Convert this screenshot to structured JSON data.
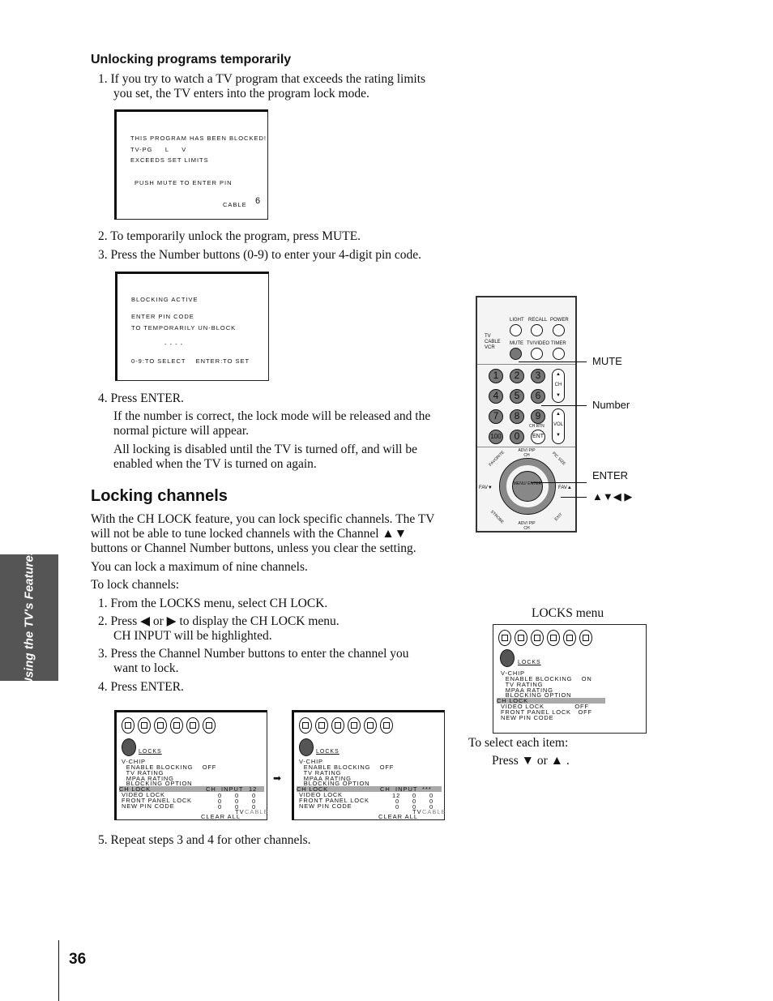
{
  "sidebar_tab": "Using the TV's Features",
  "page_number": "36",
  "unlock": {
    "heading": "Unlocking programs temporarily",
    "step1": "1.  If you try to watch a TV program that exceeds the rating limits",
    "step1b": "you set, the TV enters into the program lock mode.",
    "step2": "2.  To temporarily unlock the program, press MUTE.",
    "step3": "3.  Press the Number buttons (0-9) to enter your 4-digit pin code.",
    "step4": "4.  Press ENTER.",
    "step4a": "If the number is correct, the lock mode will be released and the",
    "step4b": "normal picture will appear.",
    "step4c": "All locking is disabled until the TV is turned off, and will be",
    "step4d": "enabled when the TV is turned on again."
  },
  "screen_blocked": {
    "l1": "THIS PROGRAM HAS BEEN BLOCKED!",
    "l2": "TV-PG     L     V",
    "l3": "EXCEEDS SET LIMITS",
    "l4": "PUSH MUTE TO ENTER PIN",
    "source": "CABLE",
    "channel": "6"
  },
  "screen_pin": {
    "l1": "BLOCKING ACTIVE",
    "l2": "ENTER PIN CODE",
    "l3": "TO TEMPORARILY UN-BLOCK",
    "l4": "- - - -",
    "l5": "0-9:TO SELECT    ENTER:TO SET"
  },
  "locking": {
    "heading": "Locking channels",
    "p1a": "With the CH LOCK feature, you can lock specific channels. The TV",
    "p1b": "will not be able to tune locked channels with the Channel ▲▼",
    "p1c": "buttons or Channel Number buttons, unless you clear the setting.",
    "p2": "You can lock a maximum of nine channels.",
    "p3": "To lock channels:",
    "s1": "1.  From the LOCKS menu, select CH LOCK.",
    "s2": "2.  Press ◀ or ▶ to display the CH LOCK menu.",
    "s2b": "CH INPUT will be highlighted.",
    "s3": "3.  Press the Channel Number buttons to enter the channel you",
    "s3b": "want to lock.",
    "s4": "4.  Press ENTER.",
    "s5": "5.  Repeat steps 3 and 4 for other channels."
  },
  "remote": {
    "top_buttons": [
      "LIGHT",
      "RECALL",
      "POWER",
      "MUTE",
      "TV/VIDEO",
      "TIMER"
    ],
    "switch": [
      "TV",
      "CABLE",
      "VCR"
    ],
    "numbers": [
      "1",
      "2",
      "3",
      "4",
      "5",
      "6",
      "7",
      "8",
      "9",
      "100",
      "0",
      "ENT"
    ],
    "ch": "CH",
    "vol": "VOL",
    "chrtn": "CH RTN",
    "nav_up": "ADV/ PIP CH",
    "nav_down": "ADV/ PIP CH",
    "fav_left": "FAV▼",
    "fav_right": "FAV▲",
    "center": "MENU/ ENTER",
    "corners": [
      "FAVORITE",
      "PIC SIZE",
      "STROBE",
      "EXIT"
    ],
    "callouts": {
      "mute": "MUTE",
      "number": "Number",
      "enter": "ENTER",
      "arrows": "▲▼◀ ▶"
    }
  },
  "locks_menu": {
    "caption": "LOCKS menu",
    "title": "LOCKS",
    "rows": [
      "V-CHIP",
      "  ENABLE BLOCKING    ON",
      "  TV RATING",
      "  MPAA RATING",
      "  BLOCKING OPTION",
      "CH LOCK",
      "VIDEO LOCK             OFF",
      "FRONT PANEL LOCK   OFF",
      "NEW PIN CODE"
    ],
    "select1": "To select each item:",
    "select2": "Press ▼ or ▲ ."
  },
  "ch_lock_before": {
    "title": "LOCKS",
    "rows": [
      "V-CHIP",
      "  ENABLE BLOCKING    OFF",
      "  TV RATING",
      "  MPAA RATING",
      "  BLOCKING OPTION",
      "CH LOCK",
      "VIDEO LOCK",
      "FRONT PANEL LOCK",
      "NEW PIN CODE"
    ],
    "ch_input": "CH  INPUT",
    "grid": [
      [
        "12"
      ],
      [
        "0",
        "0",
        "0"
      ],
      [
        "0",
        "0",
        "0"
      ],
      [
        "0",
        "0",
        "0"
      ]
    ],
    "tv": "TV",
    "cable": "CABLE",
    "clear_all": "CLEAR ALL"
  },
  "ch_lock_after": {
    "title": "LOCKS",
    "rows": [
      "V-CHIP",
      "  ENABLE BLOCKING    OFF",
      "  TV RATING",
      "  MPAA RATING",
      "  BLOCKING OPTION",
      "CH LOCK",
      "VIDEO LOCK",
      "FRONT PANEL LOCK",
      "NEW PIN CODE"
    ],
    "ch_input": "CH  INPUT",
    "grid": [
      [
        "***"
      ],
      [
        "12",
        "0",
        "0"
      ],
      [
        "0",
        "0",
        "0"
      ],
      [
        "0",
        "0",
        "0"
      ]
    ],
    "tv": "TV",
    "cable": "CABLE",
    "clear_all": "CLEAR ALL"
  }
}
